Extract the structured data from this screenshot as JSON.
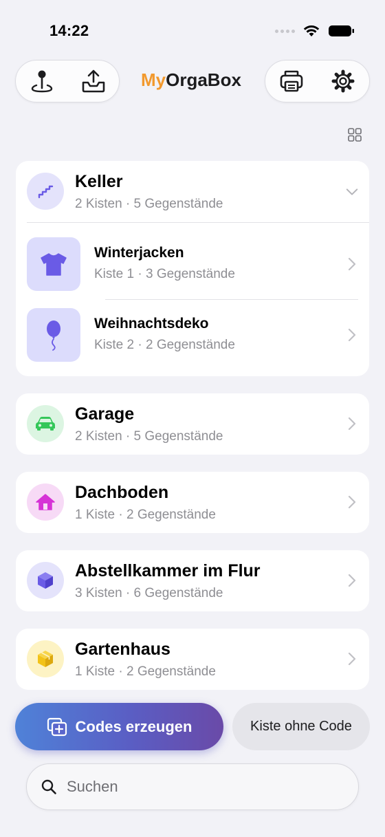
{
  "status_bar": {
    "time": "14:22"
  },
  "header": {
    "brand_prefix": "My",
    "brand_suffix": "OrgaBox",
    "left_icons": [
      "location-pin-icon",
      "inbox-upload-icon"
    ],
    "right_icons": [
      "printer-icon",
      "gear-icon"
    ]
  },
  "colors": {
    "brand_orange": "#f2992e",
    "background": "#f2f2f7",
    "keller": "#6a5be6",
    "garage": "#34c759",
    "dachboden": "#d633d6",
    "abstellkammer": "#6a5be6",
    "gartenhaus": "#f2c218"
  },
  "locations": [
    {
      "title": "Keller",
      "subtitle": "2 Kisten · 5 Gegenstände",
      "icon": "stairs-icon",
      "expanded": true,
      "boxes": [
        {
          "title": "Winterjacken",
          "subtitle": "Kiste 1 · 3 Gegenstände",
          "icon": "tshirt-icon"
        },
        {
          "title": "Weihnachtsdeko",
          "subtitle": "Kiste 2 · 2 Gegenstände",
          "icon": "balloon-icon"
        }
      ]
    },
    {
      "title": "Garage",
      "subtitle": "2 Kisten · 5 Gegenstände",
      "icon": "car-icon"
    },
    {
      "title": "Dachboden",
      "subtitle": "1 Kiste · 2 Gegenstände",
      "icon": "house-icon"
    },
    {
      "title": "Abstellkammer im Flur",
      "subtitle": "3 Kisten · 6 Gegenstände",
      "icon": "cube-icon"
    },
    {
      "title": "Gartenhaus",
      "subtitle": "1 Kiste · 2 Gegenstände",
      "icon": "shippingbox-icon"
    }
  ],
  "actions": {
    "generate_codes": "Codes erzeugen",
    "box_without_code": "Kiste ohne Code"
  },
  "search": {
    "placeholder": "Suchen"
  }
}
